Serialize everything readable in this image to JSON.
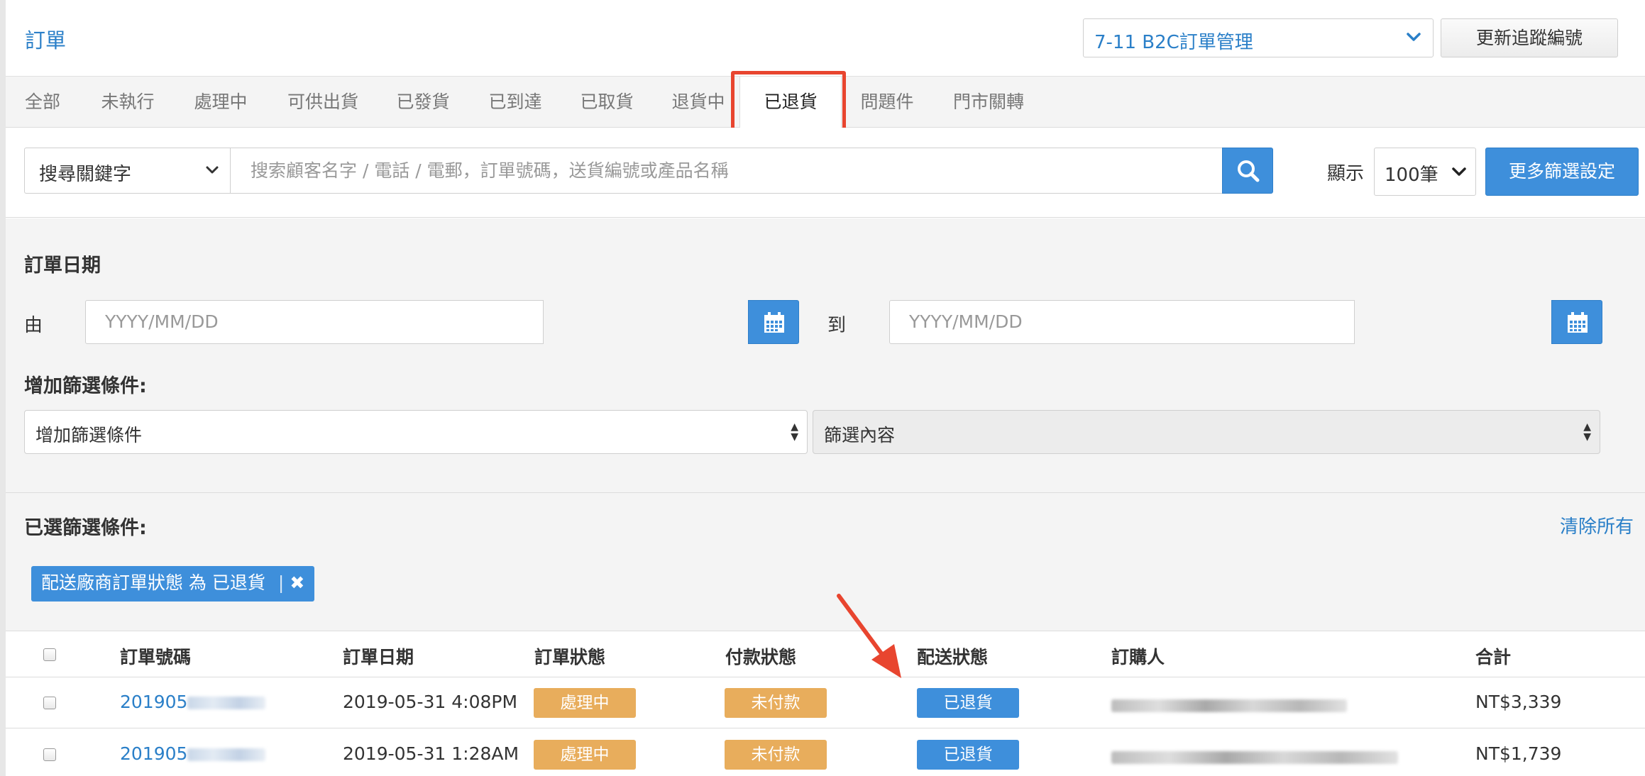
{
  "header": {
    "title": "訂單",
    "store_select": "7-11 B2C訂單管理",
    "update_tracking_button": "更新追蹤編號"
  },
  "tabs": [
    {
      "label": "全部"
    },
    {
      "label": "未執行"
    },
    {
      "label": "處理中"
    },
    {
      "label": "可供出貨"
    },
    {
      "label": "已發貨"
    },
    {
      "label": "已到達"
    },
    {
      "label": "已取貨"
    },
    {
      "label": "退貨中"
    },
    {
      "label": "已退貨"
    },
    {
      "label": "問題件"
    },
    {
      "label": "門市關轉"
    }
  ],
  "active_tab": "已退貨",
  "search": {
    "keyword_select": "搜尋關鍵字",
    "placeholder": "搜索顧客名字 / 電話 / 電郵，訂單號碼，送貨編號或產品名稱",
    "show_label": "顯示",
    "page_size": "100筆",
    "more_filters_button": "更多篩選設定"
  },
  "filters": {
    "order_date_title": "訂單日期",
    "from_label": "由",
    "to_label": "到",
    "date_placeholder": "YYYY/MM/DD",
    "add_condition_title": "增加篩選條件:",
    "add_condition_select": "增加篩選條件",
    "condition_content_select": "篩選內容",
    "selected_title": "已選篩選條件:",
    "clear_all": "清除所有",
    "chip_text": "配送廠商訂單狀態 為 已退貨",
    "chip_separator": "|",
    "chip_remove": "✖"
  },
  "table": {
    "columns": [
      "訂單號碼",
      "訂單日期",
      "訂單狀態",
      "付款狀態",
      "配送狀態",
      "訂購人",
      "合計"
    ],
    "rows": [
      {
        "order_no": "201905",
        "date": "2019-05-31 4:08PM",
        "order_status": "處理中",
        "payment_status": "未付款",
        "shipping_status": "已退貨",
        "total": "NT$3,339"
      },
      {
        "order_no": "201905",
        "date": "2019-05-31 1:28AM",
        "order_status": "處理中",
        "payment_status": "未付款",
        "shipping_status": "已退貨",
        "total": "NT$1,739"
      }
    ]
  },
  "icons": {
    "search": "search-icon",
    "calendar": "calendar-icon",
    "chevron": "chevron-down-icon"
  },
  "colors": {
    "accent": "#3e8fdb",
    "link": "#2a7fc8",
    "warning": "#e8ad5c",
    "highlight": "#e8452f"
  }
}
